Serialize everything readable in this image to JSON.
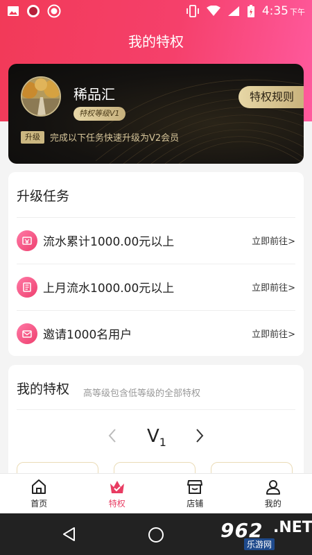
{
  "status_bar": {
    "time": "4:35",
    "ampm": "下午"
  },
  "page": {
    "title": "我的特权"
  },
  "vip_card": {
    "username": "稀品汇",
    "level": "特权等级V1",
    "rules_button": "特权规则",
    "upgrade_tag": "升级",
    "upgrade_text": "完成以下任务快速升级为V2会员"
  },
  "tasks": {
    "title": "升级任务",
    "items": [
      {
        "label": "流水累计1000.00元以上",
        "link": "立即前往>",
        "icon": "wallet-icon"
      },
      {
        "label": "上月流水1000.00元以上",
        "link": "立即前往>",
        "icon": "receipt-icon"
      },
      {
        "label": "邀请1000名用户",
        "link": "立即前往>",
        "icon": "mail-icon"
      }
    ]
  },
  "privileges": {
    "title": "我的特权",
    "subtitle": "高等级包含低等级的全部特权",
    "level_prefix": "V",
    "level_num": "1"
  },
  "tabbar": {
    "items": [
      {
        "label": "首页",
        "icon": "home-icon",
        "active": false
      },
      {
        "label": "特权",
        "icon": "crown-icon",
        "active": true
      },
      {
        "label": "店铺",
        "icon": "store-icon",
        "active": false
      },
      {
        "label": "我的",
        "icon": "user-icon",
        "active": false
      }
    ]
  },
  "watermark": {
    "number": "962",
    "dot": ".NET",
    "sub": "乐游网"
  },
  "colors": {
    "accent": "#e83c62",
    "header_start": "#f23a58",
    "header_end": "#ff5a9e",
    "gold": "#c9b37d"
  }
}
